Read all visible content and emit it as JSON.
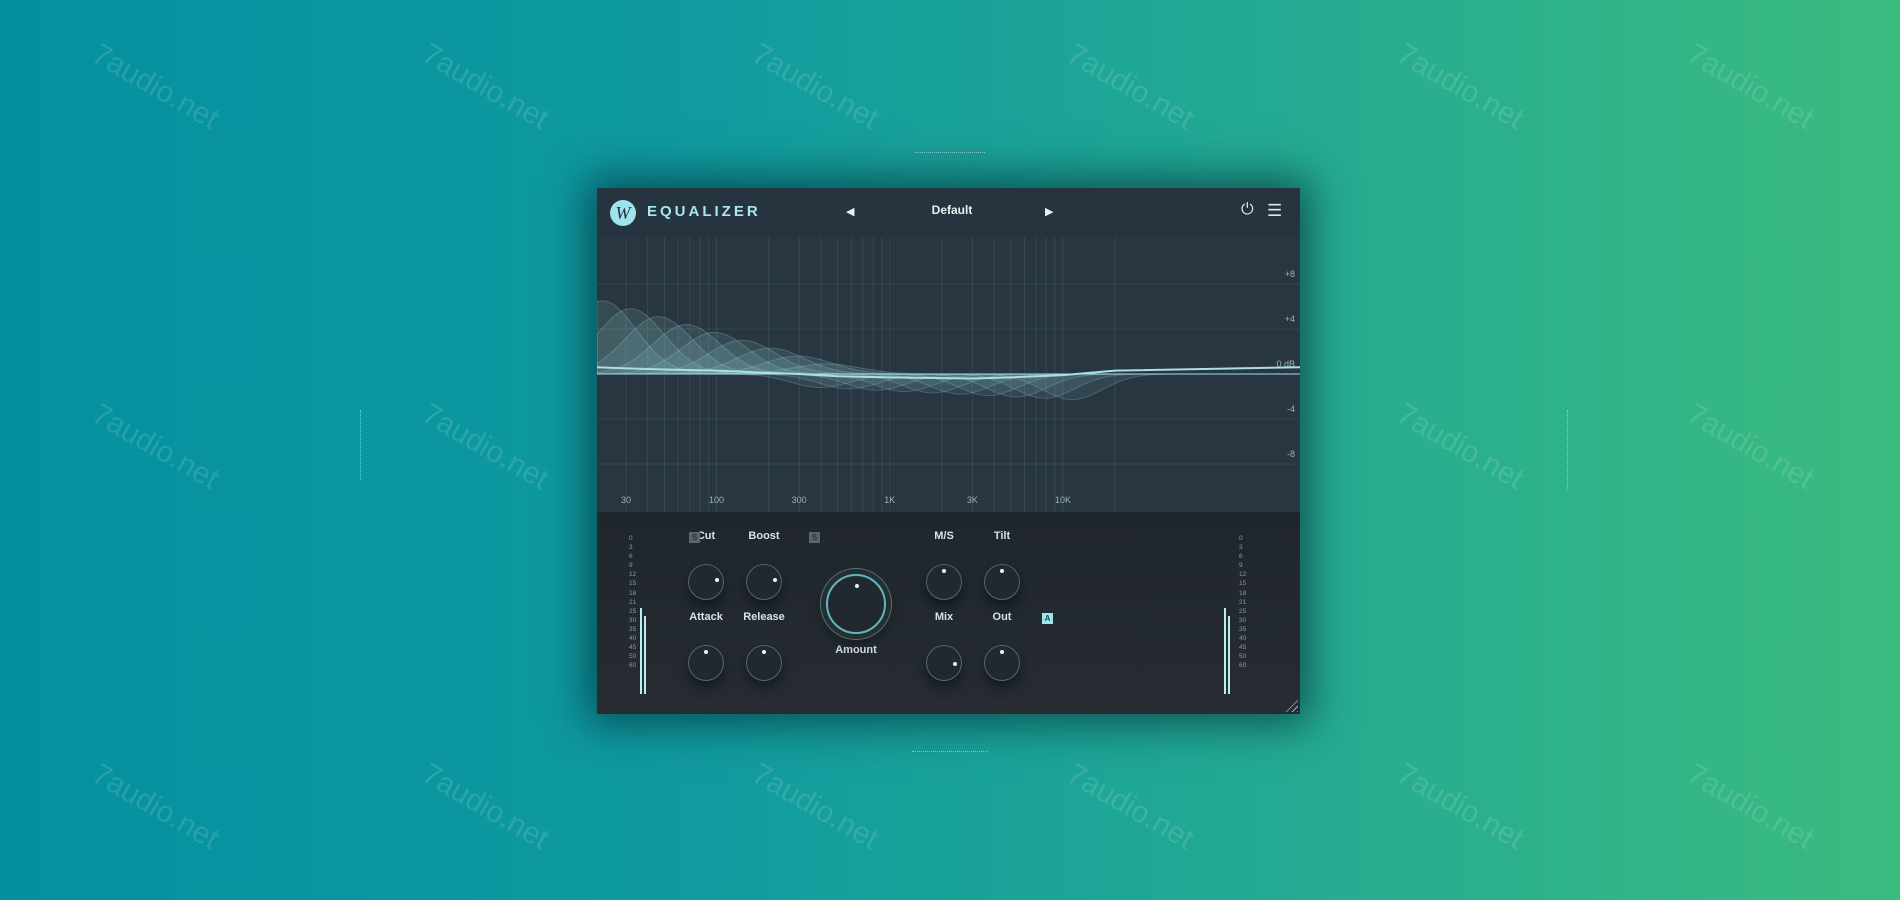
{
  "watermark": "7audio.net",
  "plugin": {
    "logo": "W",
    "title": "EQUALIZER",
    "preset": "Default",
    "prev_icon": "triangle-left",
    "next_icon": "triangle-right",
    "power_icon": "power",
    "menu_icon": "hamburger"
  },
  "graph": {
    "freq_labels": [
      {
        "f": 30,
        "t": "30"
      },
      {
        "f": 100,
        "t": "100"
      },
      {
        "f": 300,
        "t": "300"
      },
      {
        "f": 1000,
        "t": "1K"
      },
      {
        "f": 3000,
        "t": "3K"
      },
      {
        "f": 10000,
        "t": "10K"
      }
    ],
    "db_labels": [
      {
        "db": 8,
        "t": "+8"
      },
      {
        "db": 4,
        "t": "+4"
      },
      {
        "db": 0,
        "t": "0 dB"
      },
      {
        "db": -4,
        "t": "-4"
      },
      {
        "db": -8,
        "t": "-8"
      }
    ],
    "response_db": [
      [
        20,
        0.6
      ],
      [
        30,
        0.5
      ],
      [
        50,
        0.4
      ],
      [
        100,
        0.3
      ],
      [
        200,
        0.1
      ],
      [
        300,
        0
      ],
      [
        500,
        -0.2
      ],
      [
        1000,
        -0.3
      ],
      [
        3000,
        -0.4
      ],
      [
        5000,
        -0.3
      ],
      [
        10000,
        -0.1
      ],
      [
        20000,
        0.3
      ]
    ]
  },
  "controls": {
    "cut": {
      "label": "Cut",
      "badge": "S",
      "value": 0.8
    },
    "boost": {
      "label": "Boost",
      "badge": "S",
      "value": 0.8
    },
    "attack": {
      "label": "Attack",
      "value": 0.5
    },
    "release": {
      "label": "Release",
      "value": 0.5
    },
    "amount": {
      "label": "Amount",
      "value": 0.5
    },
    "ms": {
      "label": "M/S",
      "value": 0.5
    },
    "tilt": {
      "label": "Tilt",
      "value": 0.5
    },
    "mix": {
      "label": "Mix",
      "value": 0.85
    },
    "out": {
      "label": "Out",
      "badge": "A",
      "value": 0.5
    }
  },
  "meter_scale": [
    "0",
    "3",
    "6",
    "9",
    "12",
    "15",
    "18",
    "21",
    "25",
    "30",
    "35",
    "40",
    "45",
    "50",
    "60"
  ],
  "meters": {
    "in": [
      0.55,
      0.5
    ],
    "out": [
      0.55,
      0.5
    ]
  },
  "colors": {
    "accent": "#9fe4ec",
    "curve": "#a9e0e4"
  }
}
